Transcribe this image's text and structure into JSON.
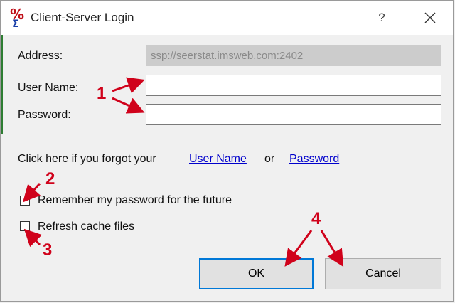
{
  "window": {
    "title": "Client-Server Login",
    "help_glyph": "?"
  },
  "form": {
    "address_label": "Address:",
    "address_value": "ssp://seerstat.imsweb.com:2402",
    "username_label": "User Name:",
    "username_value": "",
    "password_label": "Password:",
    "password_value": ""
  },
  "forgot": {
    "prefix": "Click here if you forgot your",
    "username_link": "User Name",
    "or": "or",
    "password_link": "Password"
  },
  "options": {
    "remember_label": "Remember my password for the future",
    "remember_checked": false,
    "refresh_label": "Refresh cache files",
    "refresh_checked": false
  },
  "buttons": {
    "ok": "OK",
    "cancel": "Cancel"
  },
  "annotations": {
    "n1": "1",
    "n2": "2",
    "n3": "3",
    "n4": "4",
    "color": "#d0021b"
  },
  "icons": {
    "app": "seerstat-percent-sigma-icon",
    "help": "help-icon",
    "close": "close-icon"
  }
}
